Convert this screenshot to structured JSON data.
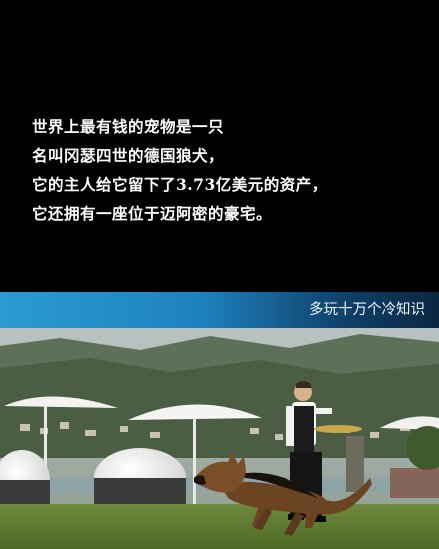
{
  "caption": {
    "lines": [
      "世界上最有钱的宠物是一只",
      "名叫冈瑟四世的德国狼犬，",
      "它的主人给它留下了3.73亿美元的资产，",
      "它还拥有一座位于迈阿密的豪宅。"
    ]
  },
  "banner": {
    "text": "多玩十万个冷知识"
  },
  "colors": {
    "background": "#000000",
    "banner_start": "#2a9bd2",
    "banner_end": "#0a2742",
    "caption_text": "#ffffff"
  }
}
